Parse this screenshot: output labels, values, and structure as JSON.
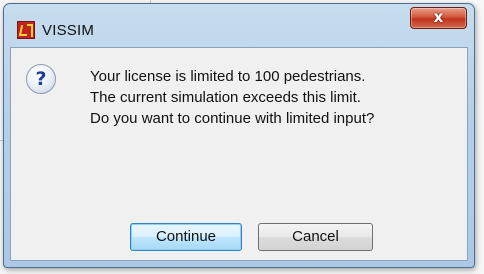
{
  "window": {
    "title": "VISSIM",
    "close_glyph": "x",
    "app_icon": "vissim-app-icon"
  },
  "dialog": {
    "icon": "question-icon",
    "icon_glyph": "?",
    "message_lines": [
      "Your license is limited to 100 pedestrians.",
      "The current simulation exceeds this limit.",
      "Do you want to continue with limited input?"
    ]
  },
  "buttons": {
    "continue_label": "Continue",
    "cancel_label": "Cancel"
  },
  "colors": {
    "title_bar": "#b5cfe8",
    "close_button": "#c1341b",
    "default_button_border": "#2f84c4",
    "dialog_background": "#f0f0f0"
  }
}
